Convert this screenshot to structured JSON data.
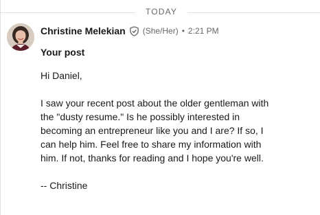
{
  "date_divider": "TODAY",
  "message": {
    "sender_name": "Christine Melekian",
    "pronouns": "(She/Her)",
    "separator": "•",
    "time": "2:21 PM",
    "subject": "Your post",
    "greeting": "Hi Daniel,",
    "paragraph_lines": [
      "I saw your recent post about the older gentleman with",
      "the \"dusty resume.\" Is he possibly interested in",
      "becoming an entrepreneur like you and I are? If so, I",
      "can help him. Feel free to share my information with",
      "him. If not, thanks for reading and I hope you're well."
    ],
    "signature": "-- Christine"
  },
  "colors": {
    "divider": "#e0dfdc",
    "secondary_text": "#666666",
    "primary_text": "#191919"
  },
  "icons": {
    "verified": "verified-shield-icon"
  }
}
